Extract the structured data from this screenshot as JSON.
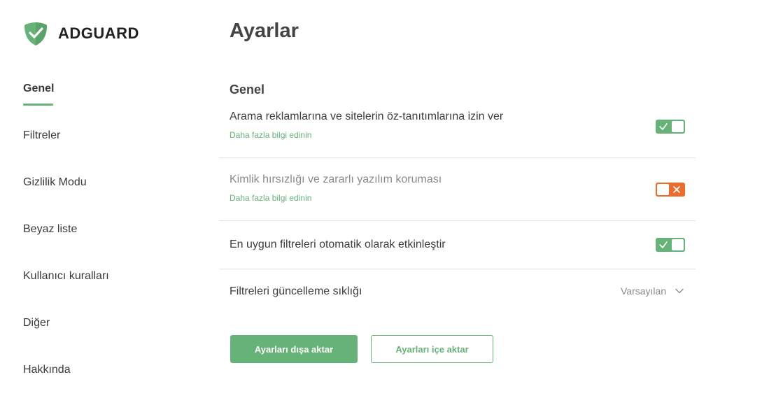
{
  "brand": {
    "name": "ADGUARD",
    "accent_color": "#67b279",
    "warning_color": "#eb6c2c",
    "logo_icon": "shield-check-icon"
  },
  "sidebar": {
    "items": [
      {
        "label": "Genel",
        "active": true
      },
      {
        "label": "Filtreler",
        "active": false
      },
      {
        "label": "Gizlilik Modu",
        "active": false
      },
      {
        "label": "Beyaz liste",
        "active": false
      },
      {
        "label": "Kullanıcı kuralları",
        "active": false
      },
      {
        "label": "Diğer",
        "active": false
      },
      {
        "label": "Hakkında",
        "active": false
      }
    ]
  },
  "main": {
    "title": "Ayarlar",
    "section_title": "Genel",
    "settings": [
      {
        "label": "Arama reklamlarına ve sitelerin öz-tanıtımlarına izin ver",
        "link": "Daha fazla bilgi edinin",
        "enabled": true
      },
      {
        "label": "Kimlik hırsızlığı ve zararlı yazılım koruması",
        "link": "Daha fazla bilgi edinin",
        "enabled": false
      },
      {
        "label": "En uygun filtreleri otomatik olarak etkinleştir",
        "enabled": true
      },
      {
        "label": "Filtreleri güncelleme sıklığı",
        "value": "Varsayılan",
        "icon": "chevron-down-icon"
      }
    ],
    "buttons": {
      "export": "Ayarları dışa aktar",
      "import": "Ayarları içe aktar"
    }
  }
}
